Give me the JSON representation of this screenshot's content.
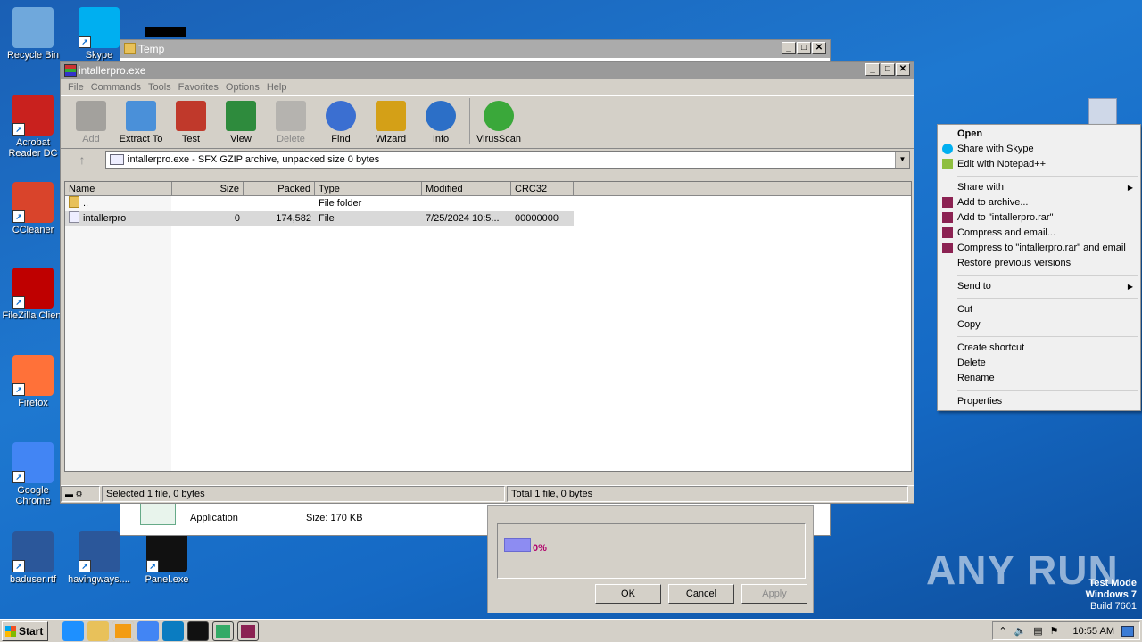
{
  "desktop": {
    "icons": [
      {
        "label": "Recycle Bin",
        "icon": "recycle-bin-icon",
        "color": "#6fa8dc"
      },
      {
        "label": "Skype",
        "icon": "skype-icon",
        "color": "#00aff0"
      },
      {
        "label": "Acrobat Reader DC",
        "icon": "acrobat-icon",
        "color": "#c9211e"
      },
      {
        "label": "CCleaner",
        "icon": "ccleaner-icon",
        "color": "#d9442b"
      },
      {
        "label": "FileZilla Client",
        "icon": "filezilla-icon",
        "color": "#bf0000"
      },
      {
        "label": "Firefox",
        "icon": "firefox-icon",
        "color": "#ff7139"
      },
      {
        "label": "Google Chrome",
        "icon": "chrome-icon",
        "color": "#4285f4"
      },
      {
        "label": "baduser.rtf",
        "icon": "word-icon",
        "color": "#2b579a"
      },
      {
        "label": "havingways....",
        "icon": "word-icon",
        "color": "#2b579a"
      },
      {
        "label": "Panel.exe",
        "icon": "panel-icon",
        "color": "#111111"
      }
    ],
    "watermark": "ANY RUN",
    "test_mode": [
      "Test Mode",
      "Windows 7",
      "Build 7601"
    ]
  },
  "temp_window": {
    "title": "Temp",
    "details": {
      "type": "Application",
      "size": "Size: 170 KB"
    }
  },
  "progress_dialog": {
    "percent": "0%",
    "progress": 0,
    "ok": "OK",
    "cancel": "Cancel",
    "apply": "Apply"
  },
  "winrar": {
    "title": "intallerpro.exe",
    "menu": [
      "File",
      "Commands",
      "Tools",
      "Favorites",
      "Options",
      "Help"
    ],
    "toolbar": [
      {
        "label": "Add",
        "icon": "add-archive-icon",
        "disabled": true
      },
      {
        "label": "Extract To",
        "icon": "extract-folder-icon",
        "disabled": false
      },
      {
        "label": "Test",
        "icon": "test-clipboard-icon",
        "disabled": false
      },
      {
        "label": "View",
        "icon": "view-book-icon",
        "disabled": false
      },
      {
        "label": "Delete",
        "icon": "trash-icon",
        "disabled": true
      },
      {
        "label": "Find",
        "icon": "magnifier-icon",
        "disabled": false
      },
      {
        "label": "Wizard",
        "icon": "magic-wand-icon",
        "disabled": false
      },
      {
        "label": "Info",
        "icon": "info-icon",
        "disabled": false
      },
      {
        "label": "VirusScan",
        "icon": "virus-scan-icon",
        "disabled": false
      }
    ],
    "address": "intallerpro.exe - SFX GZIP archive, unpacked size 0 bytes",
    "columns": [
      "Name",
      "Size",
      "Packed",
      "Type",
      "Modified",
      "CRC32"
    ],
    "rows": [
      {
        "name": "..",
        "size": "",
        "packed": "",
        "type": "File folder",
        "modified": "",
        "crc": ""
      },
      {
        "name": "intallerpro",
        "size": "0",
        "packed": "174,582",
        "type": "File",
        "modified": "7/25/2024 10:5...",
        "crc": "00000000"
      }
    ],
    "status_left": "Selected 1 file, 0 bytes",
    "status_right": "Total 1 file, 0 bytes"
  },
  "context_menu": {
    "groups": [
      [
        {
          "label": "Open",
          "bold": true,
          "icon": ""
        },
        {
          "label": "Share with Skype",
          "icon": "skype-icon"
        },
        {
          "label": "Edit with Notepad++",
          "icon": "notepad-icon"
        }
      ],
      [
        {
          "label": "Share with",
          "submenu": true,
          "icon": ""
        },
        {
          "label": "Add to archive...",
          "icon": "winrar-icon"
        },
        {
          "label": "Add to \"intallerpro.rar\"",
          "icon": "winrar-icon"
        },
        {
          "label": "Compress and email...",
          "icon": "winrar-icon"
        },
        {
          "label": "Compress to \"intallerpro.rar\" and email",
          "icon": "winrar-icon"
        },
        {
          "label": "Restore previous versions",
          "icon": ""
        }
      ],
      [
        {
          "label": "Send to",
          "submenu": true,
          "icon": ""
        }
      ],
      [
        {
          "label": "Cut",
          "icon": ""
        },
        {
          "label": "Copy",
          "icon": ""
        }
      ],
      [
        {
          "label": "Create shortcut",
          "icon": ""
        },
        {
          "label": "Delete",
          "icon": ""
        },
        {
          "label": "Rename",
          "icon": ""
        }
      ],
      [
        {
          "label": "Properties",
          "icon": ""
        }
      ]
    ]
  },
  "taskbar": {
    "start": "Start",
    "clock": "10:55 AM",
    "items": [
      "ie-icon",
      "explorer-icon",
      "media-player-icon",
      "chrome-icon",
      "edge-icon",
      "panel-icon",
      "network-app-icon",
      "winrar-icon"
    ]
  }
}
